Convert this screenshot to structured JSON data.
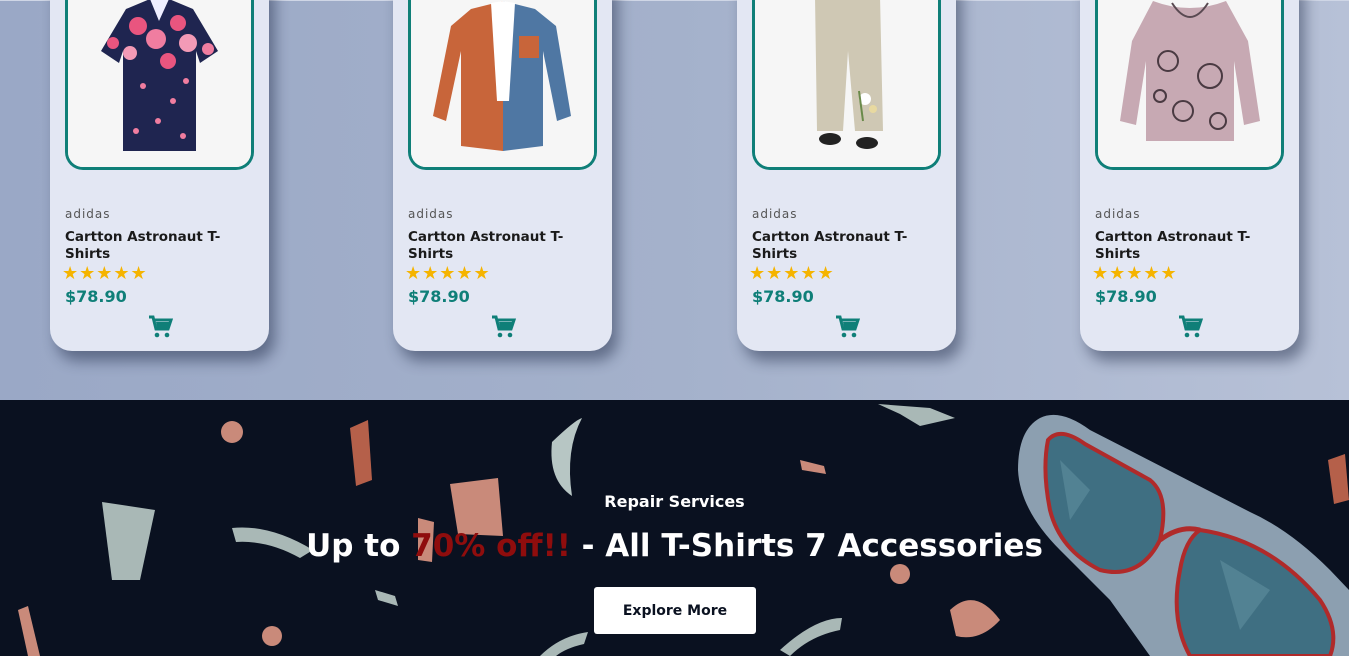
{
  "products": [
    {
      "brand": "adidas",
      "title": "Cartton Astronaut T-Shirts",
      "rating": 5,
      "stars": "★★★★★",
      "price": "$78.90",
      "image": "floral-shirt-image"
    },
    {
      "brand": "adidas",
      "title": "Cartton Astronaut T-Shirts",
      "rating": 5,
      "stars": "★★★★★",
      "price": "$78.90",
      "image": "denim-orange-shirt-image"
    },
    {
      "brand": "adidas",
      "title": "Cartton Astronaut T-Shirts",
      "rating": 5,
      "stars": "★★★★★",
      "price": "$78.90",
      "image": "linen-pants-image"
    },
    {
      "brand": "adidas",
      "title": "Cartton Astronaut T-Shirts",
      "rating": 5,
      "stars": "★★★★★",
      "price": "$78.90",
      "image": "cat-print-top-image"
    }
  ],
  "promo": {
    "subtitle": "Repair Services",
    "title_prefix": "Up to ",
    "title_highlight": "70% off!!",
    "title_suffix": " - All T-Shirts 7 Accessories",
    "button_label": "Explore More"
  },
  "colors": {
    "accent": "#0f7f78",
    "star": "#f5b400",
    "highlight": "#8f0d0d",
    "promo_bg": "#0a1120"
  },
  "icons": {
    "cart": "shopping-cart-icon"
  }
}
